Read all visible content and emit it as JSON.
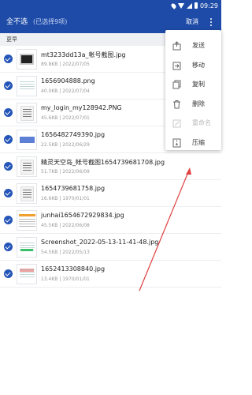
{
  "status_bar": {
    "time": "09:29",
    "icons": [
      "location-icon",
      "wifi-icon",
      "signal-icon",
      "battery-icon"
    ]
  },
  "app_bar": {
    "deselect_all": "全不选",
    "selected_count": "(已选择9项)",
    "cancel": "取消",
    "more_icon": "more-vert-icon"
  },
  "section": {
    "label": "更早"
  },
  "files": [
    {
      "name": "mt3233dd13a_帐号截图.jpg",
      "size": "89.8KB",
      "date": "2022/07/05",
      "thumb": "dark"
    },
    {
      "name": "1656904888.png",
      "size": "40.0KB",
      "date": "2022/07/04",
      "thumb": "lines"
    },
    {
      "name": "my_login_my128942.PNG",
      "size": "45.6KB",
      "date": "2022/07/01",
      "thumb": "scan"
    },
    {
      "name": "1656482749390.jpg",
      "size": "22.5KB",
      "date": "2022/06/29",
      "thumb": "blue"
    },
    {
      "name": "精灵天空岛_帐号截图1654739681708.jpg",
      "size": "51.7KB",
      "date": "2022/06/09",
      "thumb": "scan"
    },
    {
      "name": "1654739681758.jpg",
      "size": "16.6KB",
      "date": "1970/01/01",
      "thumb": "scan"
    },
    {
      "name": "junhai1654672929834.jpg",
      "size": "45.5KB",
      "date": "2022/06/08",
      "thumb": "orange"
    },
    {
      "name": "Screenshot_2022-05-13-11-41-48.jpg",
      "size": "54.5KB",
      "date": "2022/05/13",
      "thumb": "green"
    },
    {
      "name": "1652413308840.jpg",
      "size": "13.4KB",
      "date": "1970/01/01",
      "thumb": "redline"
    }
  ],
  "menu": {
    "items": [
      {
        "label": "发送",
        "icon": "send-icon",
        "enabled": true
      },
      {
        "label": "移动",
        "icon": "move-icon",
        "enabled": true
      },
      {
        "label": "复制",
        "icon": "copy-icon",
        "enabled": true
      },
      {
        "label": "删除",
        "icon": "delete-icon",
        "enabled": true
      },
      {
        "label": "重命名",
        "icon": "rename-icon",
        "enabled": false
      },
      {
        "label": "压缩",
        "icon": "compress-icon",
        "enabled": true
      }
    ]
  },
  "colors": {
    "app_bar": "#1e4ba8",
    "check": "#2455b8",
    "annotation_arrow": "#e04040"
  }
}
